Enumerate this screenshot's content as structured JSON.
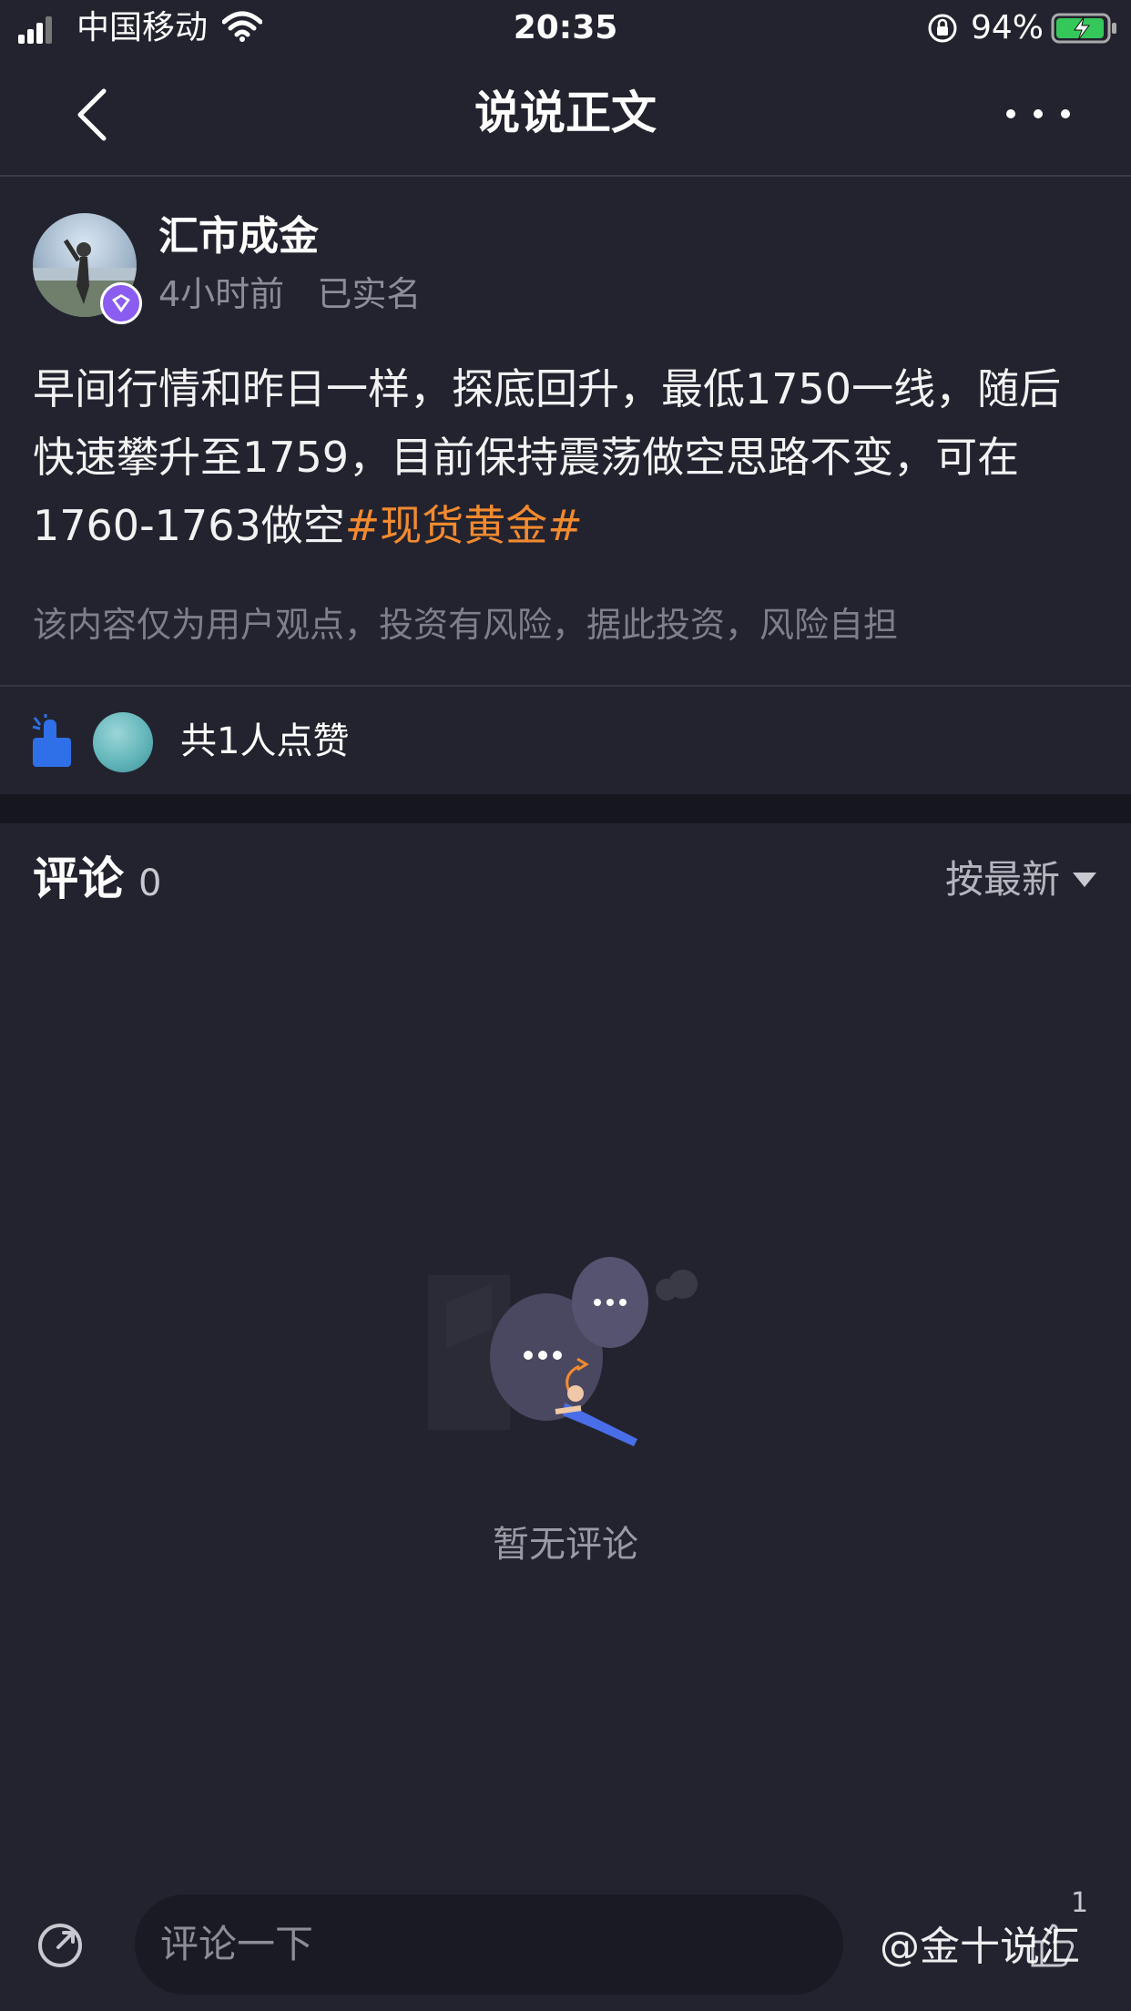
{
  "status_bar": {
    "carrier": "中国移动",
    "time": "20:35",
    "battery": "94%"
  },
  "nav": {
    "title": "说说正文"
  },
  "post": {
    "author": "汇市成金",
    "meta": "4小时前   已实名",
    "body_text": "早间行情和昨日一样，探底回升，最低1750一线，随后快速攀升至1759，目前保持震荡做空思路不变，可在1760-1763做空",
    "hashtag": "#现货黄金#",
    "disclaimer": "该内容仅为用户观点，投资有风险，据此投资，风险自担"
  },
  "likes": {
    "summary": "共1人点赞"
  },
  "comments": {
    "label": "评论",
    "count": "0",
    "sort_label": "按最新",
    "empty_text": "暂无评论"
  },
  "bottom_bar": {
    "input_placeholder": "评论一下",
    "like_count": "1",
    "watermark": "@金十说汇"
  },
  "colors": {
    "background": "#23232f",
    "hashtag": "#f28a2e",
    "like_blue": "#2f6fe8",
    "verified_badge": "#8a5cf0"
  }
}
